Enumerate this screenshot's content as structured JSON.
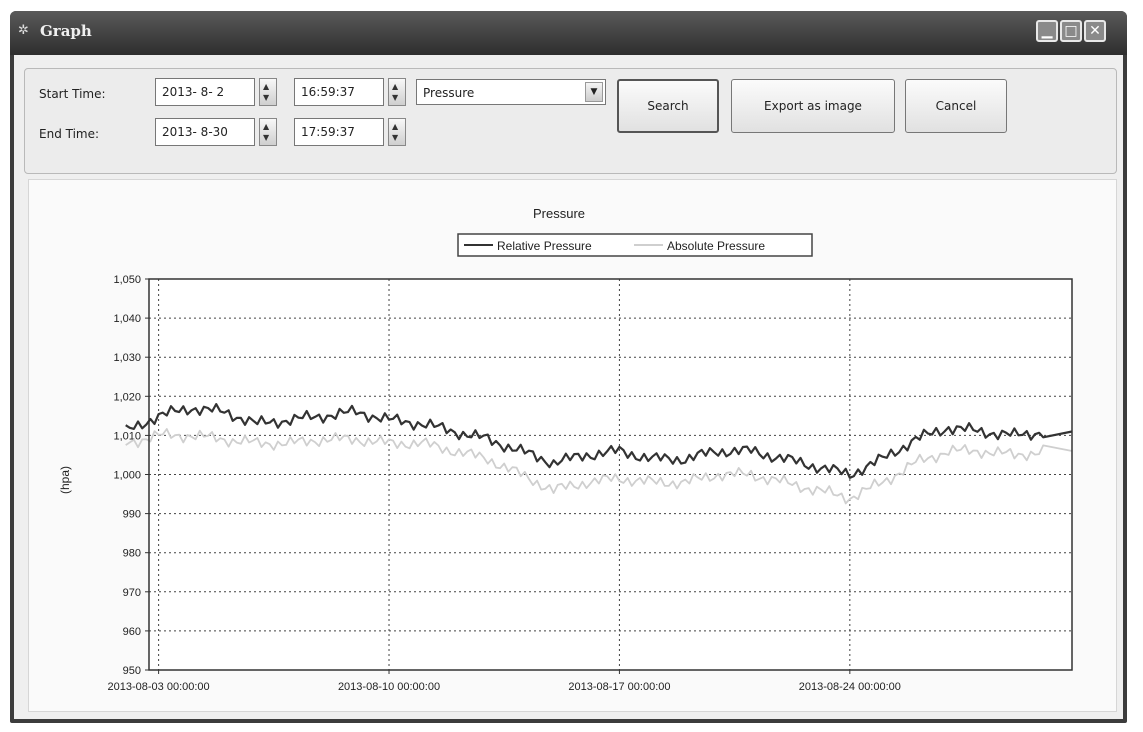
{
  "window": {
    "title": "Graph"
  },
  "form": {
    "start_label": "Start Time:",
    "end_label": "End Time:",
    "start_date": "2013- 8- 2",
    "start_time": "16:59:37",
    "end_date": "2013- 8-30",
    "end_time": "17:59:37",
    "measurement": "Pressure"
  },
  "buttons": {
    "search": "Search",
    "export": "Export as image",
    "cancel": "Cancel"
  },
  "chart_data": {
    "type": "line",
    "title": "Pressure",
    "xlabel": "",
    "ylabel": "(hpa)",
    "ylim": [
      950,
      1050
    ],
    "yticks": [
      "1,050",
      "1,040",
      "1,030",
      "1,020",
      "1,010",
      "1,000",
      "990",
      "980",
      "970",
      "960",
      "950"
    ],
    "xticks": [
      "2013-08-03 00:00:00",
      "2013-08-10 00:00:00",
      "2013-08-17 00:00:00",
      "2013-08-24 00:00:00"
    ],
    "xlim": [
      "2013-08-02 16:59:37",
      "2013-08-30 17:59:37"
    ],
    "grid": true,
    "legend_position": "top-center",
    "x": [
      "2013-08-02",
      "2013-08-03",
      "2013-08-04",
      "2013-08-05",
      "2013-08-06",
      "2013-08-07",
      "2013-08-08",
      "2013-08-09",
      "2013-08-10",
      "2013-08-11",
      "2013-08-12",
      "2013-08-13",
      "2013-08-14",
      "2013-08-15",
      "2013-08-16",
      "2013-08-17",
      "2013-08-18",
      "2013-08-19",
      "2013-08-20",
      "2013-08-21",
      "2013-08-22",
      "2013-08-23",
      "2013-08-24",
      "2013-08-25",
      "2013-08-26",
      "2013-08-27",
      "2013-08-28",
      "2013-08-29",
      "2013-08-30"
    ],
    "series": [
      {
        "name": "Relative Pressure",
        "color": "#333333",
        "values": [
          1011,
          1015,
          1017,
          1016,
          1013,
          1014,
          1015,
          1016,
          1014,
          1013,
          1011,
          1009,
          1006,
          1003,
          1005,
          1006,
          1004,
          1004,
          1006,
          1006,
          1004,
          1002,
          1000,
          1004,
          1009,
          1012,
          1011,
          1010,
          1011
        ]
      },
      {
        "name": "Absolute Pressure",
        "color": "#cfcfcf",
        "values": [
          1008,
          1010,
          1010,
          1009,
          1008,
          1008,
          1009,
          1009,
          1008,
          1008,
          1006,
          1004,
          1000,
          996,
          998,
          999,
          998,
          998,
          1000,
          1000,
          998,
          996,
          994,
          998,
          1003,
          1006,
          1006,
          1005,
          1006
        ]
      }
    ]
  }
}
